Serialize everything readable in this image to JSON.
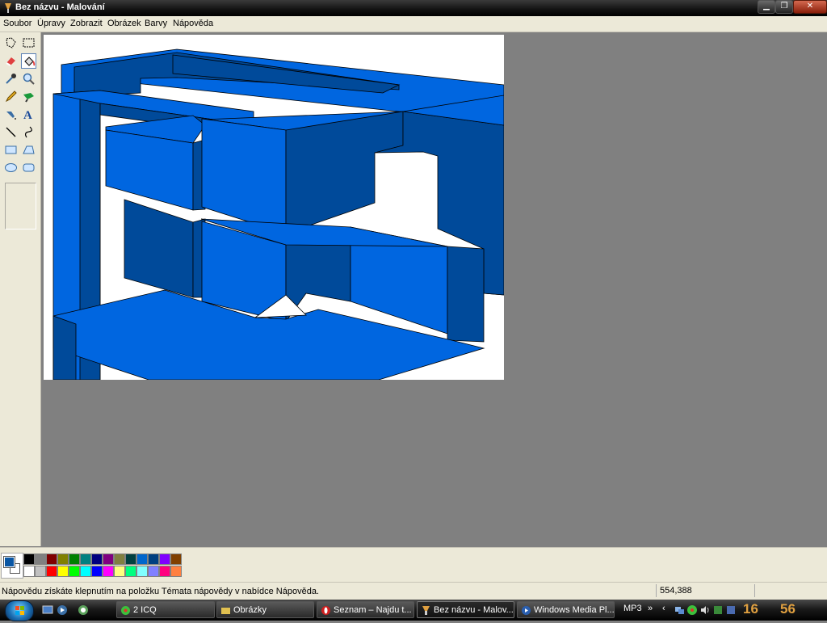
{
  "window": {
    "title": "Bez názvu - Malování"
  },
  "menu": [
    "Soubor",
    "Úpravy",
    "Zobrazit",
    "Obrázek",
    "Barvy",
    "Nápověda"
  ],
  "status": {
    "hint": "Nápovědu získáte klepnutím na položku Témata nápovědy v nabídce Nápověda.",
    "coords": "554,388"
  },
  "palette": {
    "foreground": "#0a56a4",
    "background": "#ffffff",
    "row1": [
      "#000000",
      "#808080",
      "#800000",
      "#808000",
      "#008000",
      "#008080",
      "#000080",
      "#800080",
      "#808040",
      "#004040",
      "#0066cc",
      "#004080",
      "#8000ff",
      "#804000"
    ],
    "row2": [
      "#ffffff",
      "#c0c0c0",
      "#ff0000",
      "#ffff00",
      "#00ff00",
      "#00ffff",
      "#0000ff",
      "#ff00ff",
      "#ffff80",
      "#00ff80",
      "#80ffff",
      "#8080ff",
      "#ff0080",
      "#ff8040"
    ]
  },
  "taskbar": {
    "tasks": [
      {
        "label": "2 ICQ"
      },
      {
        "label": "Obrázky"
      },
      {
        "label": "Seznam – Najdu t..."
      },
      {
        "label": "Bez názvu - Malov..."
      },
      {
        "label": "Windows Media Pl..."
      }
    ],
    "tray_label": "MP3",
    "clock_hour": "16",
    "clock_min": "56"
  },
  "colors": {
    "paint_blue": "#0066e0",
    "paint_dark": "#004a9a",
    "paint_mid": "#0059c0"
  }
}
